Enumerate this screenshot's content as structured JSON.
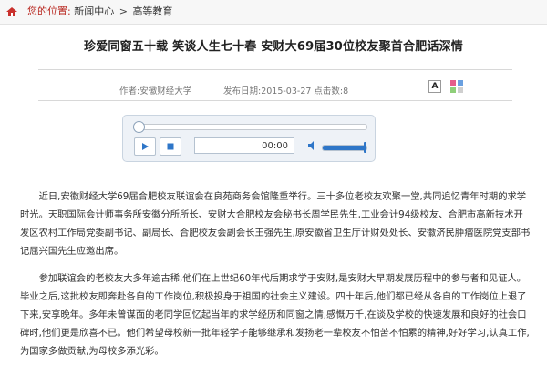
{
  "breadcrumb": {
    "label": "您的位置:",
    "items": [
      "新闻中心",
      "高等教育"
    ],
    "separator": ">"
  },
  "article": {
    "title": "珍爱同窗五十载 笑谈人生七十春 安财大69届30位校友聚首合肥话深情",
    "author": "作者:安徽财经大学",
    "published": "发布日期:2015-03-27 点击数:8",
    "font_button": "A",
    "paragraphs": [
      "近日,安徽财经大学69届合肥校友联谊会在良苑商务会馆隆重举行。三十多位老校友欢聚一堂,共同追忆青年时期的求学时光。天职国际会计师事务所安徽分所所长、安财大合肥校友会秘书长周学民先生,工业会计94级校友、合肥市高新技术开发区农村工作局党委副书记、副局长、合肥校友会副会长王强先生,原安徽省卫生厅计财处处长、安徽济民肿瘤医院党支部书记屈兴国先生应邀出席。",
      "参加联谊会的老校友大多年逾古稀,他们在上世纪60年代后期求学于安财,是安财大早期发展历程中的参与者和见证人。毕业之后,这批校友即奔赴各自的工作岗位,积极投身于祖国的社会主义建设。四十年后,他们都已经从各自的工作岗位上退了下来,安享晚年。多年未曾谋面的老同学回忆起当年的求学经历和同窗之情,感慨万千,在谈及学校的快速发展和良好的社会口碑时,他们更是欣喜不已。他们希望母校新一批年轻学子能够继承和发扬老一辈校友不怕苦不怕累的精神,好好学习,认真工作,为国家多做贡献,为母校多添光彩。"
    ]
  },
  "player": {
    "time": "00:00",
    "progress": 0.0,
    "volume": 1.0
  },
  "colors": {
    "breadcrumb_label": "#b8261e",
    "accent": "#2e76c8"
  }
}
